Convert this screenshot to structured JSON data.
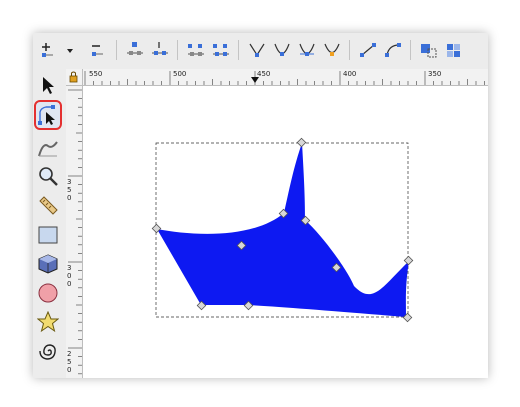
{
  "icons": {
    "toolbar": [
      "add-node-icon",
      "dropdown-arrow-icon",
      "delete-node-icon",
      "join-nodes-icon",
      "break-path-icon",
      "join-segment-icon",
      "delete-segment-icon",
      "cusp-node-icon",
      "smooth-node-icon",
      "symmetric-node-icon",
      "auto-smooth-node-icon",
      "segment-line-icon",
      "segment-curve-icon",
      "object-to-path-icon",
      "stroke-to-path-icon"
    ],
    "tools": [
      "selector-tool-icon",
      "node-tool-icon",
      "tweak-tool-icon",
      "zoom-tool-icon",
      "measure-tool-icon",
      "rectangle-tool-icon",
      "3d-box-tool-icon",
      "ellipse-tool-icon",
      "star-tool-icon",
      "spiral-tool-icon"
    ]
  },
  "ruler": {
    "h_labels": [
      "550",
      "500",
      "450",
      "400",
      "350"
    ],
    "v_labels": [
      "3",
      "5",
      "0",
      "3",
      "0",
      "0",
      "2",
      "5",
      "0"
    ]
  },
  "colors": {
    "shape_fill": "#0d19f2",
    "active_tool_border": "#e43030",
    "node_fill": "#d8d8d8"
  }
}
